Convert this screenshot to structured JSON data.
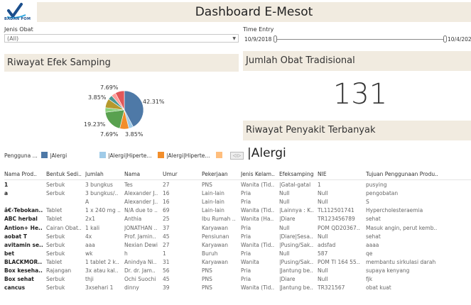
{
  "header": {
    "logo_text": "BADAN POM",
    "title": "Dashboard E-Mesot"
  },
  "filters": {
    "jenis_obat": {
      "label": "Jenis Obat",
      "value": "(All)"
    },
    "time_entry": {
      "label": "Time Entry",
      "start": "10/9/2018",
      "end": "10/4/202"
    }
  },
  "sections": {
    "efek": "Riwayat Efek Samping",
    "jumlah": "Jumlah Obat Tradisional",
    "riwayat": "Riwayat Penyakit Terbanyak"
  },
  "kpi": {
    "value": "131"
  },
  "legend": {
    "title": "Pengguna ...",
    "items": [
      {
        "label": "|Alergi",
        "color": "#4e79a7"
      },
      {
        "label": "|Alergi|Hiperte...",
        "color": "#a0cbe8"
      },
      {
        "label": "|Alergi|Hiperte...",
        "color": "#f28e2b"
      },
      {
        "label": "",
        "color": "#ffbe7d"
      }
    ],
    "nav": "◁ ▷"
  },
  "riwayat_top": "|Alergi",
  "chart_data": {
    "type": "pie",
    "values": [
      42.31,
      3.85,
      7.69,
      19.23,
      3.85,
      7.69,
      3.85,
      3.85,
      7.69
    ],
    "colors": [
      "#4e79a7",
      "#a0cbe8",
      "#f28e2b",
      "#59a14f",
      "#8cd17d",
      "#b6992d",
      "#499894",
      "#ff9d9a",
      "#e15759"
    ],
    "labels": [
      "42.31%",
      "3.85%",
      "7.69%",
      "19.23%",
      "3.85%",
      "7.69%"
    ]
  },
  "table": {
    "columns": [
      "Nama Prod..",
      "Bentuk Sedi..",
      "Jumlah",
      "Nama",
      "Umur",
      "Pekerjaan",
      "Jenis Kelam..",
      "Efeksamping",
      "NIE",
      "Tujuan Penggunaan Produ.."
    ],
    "rows": [
      [
        "1",
        "Serbuk",
        "3 bungkus",
        "Tes",
        "27",
        "PNS",
        "Wanita (Tid..",
        "|Gatal-gatal",
        "1",
        "pusying"
      ],
      [
        "a",
        "Serbuk",
        "3 bungkus/..",
        "Alexander J..",
        "16",
        "Lain-lain",
        "Pria",
        "Null",
        "Null",
        "pengobatan"
      ],
      [
        "",
        "",
        "A",
        "Alexander J..",
        "16",
        "Lain-lain",
        "Pria",
        "Null",
        "Null",
        "S"
      ],
      [
        "â€‹Tebokan..",
        "Tablet",
        "1 x 240 mg ..",
        "N/A due to ..",
        "69",
        "Lain-lain",
        "Wanita (Tid..",
        "|Lainnya : K..",
        "TL112501741",
        "Hypercholesteraemia"
      ],
      [
        "ABC herbal",
        "Tablet",
        "2x1",
        "Anthia",
        "25",
        "Ibu Rumah ..",
        "Wanita (Ha..",
        "|Diare",
        "TR123456789",
        "sehat"
      ],
      [
        "Antion+ He..",
        "Cairan Obat..",
        "1 kali",
        "JONATHAN ..",
        "37",
        "Karyawan",
        "Pria",
        "Null",
        "POM QD20367..",
        "Masuk angin, perut kemb.."
      ],
      [
        "aobat T",
        "Serbuk",
        "4x",
        "Prof. Jamin..",
        "45",
        "Pensiunan",
        "Pria",
        "|Diare|Sesa..",
        "Null",
        "sehat"
      ],
      [
        "avitamin se..",
        "Serbuk",
        "aaa",
        "Nexian Dewi",
        "27",
        "Karyawan",
        "Wanita (Tid..",
        "|Pusing/Sak..",
        "adsfad",
        "aaaa"
      ],
      [
        "bet",
        "Serbuk",
        "wk",
        "h",
        "1",
        "Buruh",
        "Pria",
        "Null",
        "587",
        "qe"
      ],
      [
        "BLACKMOR..",
        "Tablet",
        "1 tablet 2 k..",
        "Anindya Ni..",
        "31",
        "Karyawan",
        "Wanita",
        "|Pusing/Sak..",
        "POM TI 164 55..",
        "membantu sirkulasi darah"
      ],
      [
        "Box keseha..",
        "Rajangan",
        "3x atau kal..",
        "Dr. dr. Jam..",
        "56",
        "PNS",
        "Pria",
        "|Jantung be..",
        "Null",
        "supaya kenyang"
      ],
      [
        "Box sehat",
        "Serbuk",
        "thji",
        "Ochi Suochi",
        "45",
        "PNS",
        "Pria",
        "|Diare",
        "Null",
        "fjk"
      ],
      [
        "cancus",
        "Serbuk",
        "3xsehari 1",
        "dinny",
        "39",
        "PNS",
        "Wanita (Tid..",
        "|Jantung be..",
        "TR321567",
        "obat kuat"
      ]
    ]
  }
}
